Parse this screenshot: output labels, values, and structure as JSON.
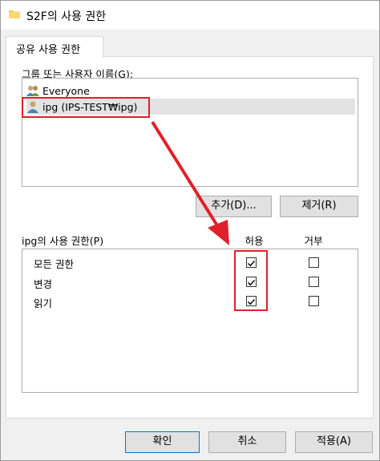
{
  "window": {
    "title": "S2F의 사용 권한"
  },
  "tab": {
    "label": "공유 사용 권한"
  },
  "group_section": {
    "label": "그룹 또는 사용자 이름(G):",
    "users": [
      {
        "name": "Everyone",
        "icon": "users-group-icon",
        "selected": false
      },
      {
        "name": "ipg (IPS-TEST₩ipg)",
        "icon": "user-icon",
        "selected": true
      }
    ]
  },
  "buttons": {
    "add": "추가(D)...",
    "remove": "제거(R)",
    "ok": "확인",
    "cancel": "취소",
    "apply": "적용(A)"
  },
  "permissions": {
    "label": "ipg의 사용 권한(P)",
    "allow_header": "허용",
    "deny_header": "거부",
    "rows": [
      {
        "name": "모든 권한",
        "allow": true,
        "deny": false
      },
      {
        "name": "변경",
        "allow": true,
        "deny": false
      },
      {
        "name": "읽기",
        "allow": true,
        "deny": false
      }
    ]
  },
  "colors": {
    "highlight": "#e0202a",
    "accent": "#0078d7"
  }
}
